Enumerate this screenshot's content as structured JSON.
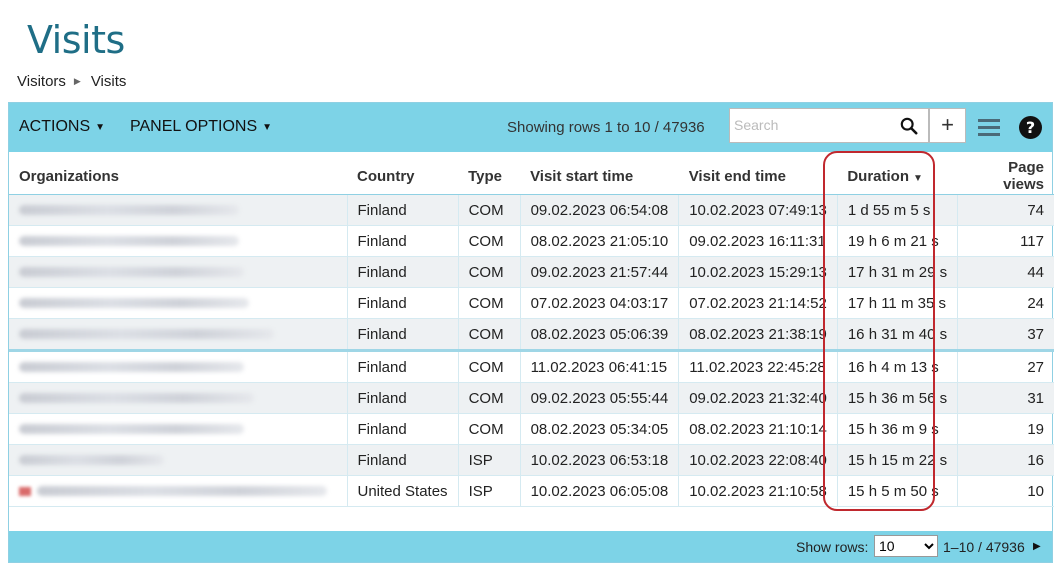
{
  "page": {
    "title": "Visits"
  },
  "breadcrumb": {
    "items": [
      "Visitors",
      "Visits"
    ]
  },
  "toolbar": {
    "actions_label": "ACTIONS",
    "panel_options_label": "PANEL OPTIONS",
    "showing_text": "Showing rows 1 to 10 / 47936",
    "search_placeholder": "Search",
    "add_label": "+",
    "help_label": "?"
  },
  "table": {
    "columns": [
      "Organizations",
      "Country",
      "Type",
      "Visit start time",
      "Visit end time",
      "Duration",
      "Page views"
    ],
    "rows": [
      {
        "country": "Finland",
        "type": "COM",
        "start": "09.02.2023 06:54:08",
        "end": "10.02.2023 07:49:13",
        "duration": "1 d 55 m 5 s",
        "views": "74"
      },
      {
        "country": "Finland",
        "type": "COM",
        "start": "08.02.2023 21:05:10",
        "end": "09.02.2023 16:11:31",
        "duration": "19 h 6 m 21 s",
        "views": "117"
      },
      {
        "country": "Finland",
        "type": "COM",
        "start": "09.02.2023 21:57:44",
        "end": "10.02.2023 15:29:13",
        "duration": "17 h 31 m 29 s",
        "views": "44"
      },
      {
        "country": "Finland",
        "type": "COM",
        "start": "07.02.2023 04:03:17",
        "end": "07.02.2023 21:14:52",
        "duration": "17 h 11 m 35 s",
        "views": "24"
      },
      {
        "country": "Finland",
        "type": "COM",
        "start": "08.02.2023 05:06:39",
        "end": "08.02.2023 21:38:19",
        "duration": "16 h 31 m 40 s",
        "views": "37"
      },
      {
        "country": "Finland",
        "type": "COM",
        "start": "11.02.2023 06:41:15",
        "end": "11.02.2023 22:45:28",
        "duration": "16 h 4 m 13 s",
        "views": "27"
      },
      {
        "country": "Finland",
        "type": "COM",
        "start": "09.02.2023 05:55:44",
        "end": "09.02.2023 21:32:40",
        "duration": "15 h 36 m 56 s",
        "views": "31"
      },
      {
        "country": "Finland",
        "type": "COM",
        "start": "08.02.2023 05:34:05",
        "end": "08.02.2023 21:10:14",
        "duration": "15 h 36 m 9 s",
        "views": "19"
      },
      {
        "country": "Finland",
        "type": "ISP",
        "start": "10.02.2023 06:53:18",
        "end": "10.02.2023 22:08:40",
        "duration": "15 h 15 m 22 s",
        "views": "16"
      },
      {
        "country": "United States",
        "type": "ISP",
        "start": "10.02.2023 06:05:08",
        "end": "10.02.2023 21:10:58",
        "duration": "15 h 5 m 50 s",
        "views": "10"
      }
    ]
  },
  "footer": {
    "show_rows_label": "Show rows:",
    "rows_value": "10",
    "range_text": "1–10 / 47936"
  },
  "colors": {
    "accent": "#7dd3e7",
    "title": "#1f6e86",
    "highlight": "#c0282e"
  }
}
